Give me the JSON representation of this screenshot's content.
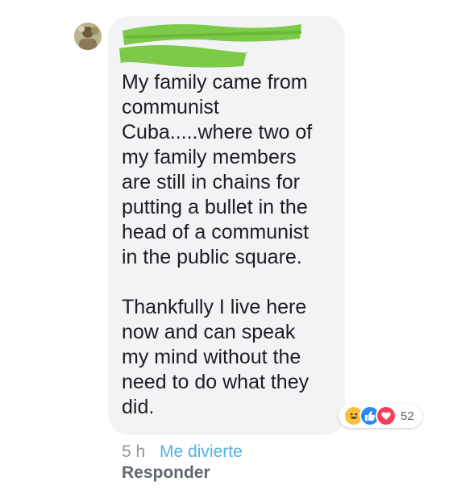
{
  "comment": {
    "paragraphs": [
      "My family came from\ncommunist\nCuba.....where two of\nmy family members\nare still in chains for\nputting a bullet in the\nhead of a communist\nin the public square.",
      "Thankfully I live here\nnow and can speak\nmy mind without the\nneed to do what they\ndid."
    ]
  },
  "reactions": {
    "icons": [
      "haha-icon",
      "like-icon",
      "love-icon"
    ],
    "count": "52"
  },
  "meta": {
    "time": "5 h",
    "action": "Me divierte",
    "reply": "Responder"
  },
  "colors": {
    "bubble": "#f2f3f5",
    "redaction": "#7dc948",
    "link": "#4fb4e6"
  }
}
